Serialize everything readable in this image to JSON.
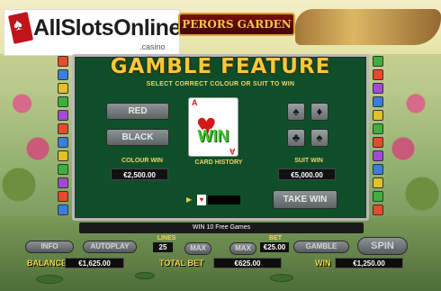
{
  "logo": {
    "text": "AllSlotsOnline",
    "sub": ".casino"
  },
  "game": {
    "title": "PERORS GARDEN"
  },
  "gamble": {
    "title": "GAMBLE FEATURE",
    "subtitle": "SELECT CORRECT COLOUR OR SUIT TO WIN",
    "red_label": "RED",
    "black_label": "BLACK",
    "colour_win_label": "COLOUR WIN",
    "colour_win_value": "€2,500.00",
    "suit_win_label": "SUIT WIN",
    "suit_win_value": "€5,000.00",
    "card_history_label": "CARD HISTORY",
    "card_rank": "A",
    "card_suit": "♥",
    "result_text": "WIN",
    "take_win_label": "TAKE WIN",
    "suits": [
      "♠",
      "♦",
      "♣",
      "♠"
    ]
  },
  "status": {
    "message": "WIN 10 Free Games"
  },
  "controls": {
    "info_label": "INFO",
    "autoplay_label": "AUTOPLAY",
    "lines_label": "LINES",
    "lines_value": "25",
    "max1_label": "MAX",
    "max2_label": "MAX",
    "bet_label": "BET",
    "bet_value": "€25.00",
    "gamble_label": "GAMBLE",
    "spin_label": "SPIN",
    "balance_label": "BALANCE",
    "balance_value": "€1,625.00",
    "total_bet_label": "TOTAL BET",
    "total_bet_value": "€625.00",
    "win_label": "WIN",
    "win_value": "€1,250.00"
  },
  "colors": {
    "panel_green": "#0e4f2a",
    "gold": "#f5c938",
    "red": "#d21a1a",
    "win_green": "#43c52b"
  }
}
